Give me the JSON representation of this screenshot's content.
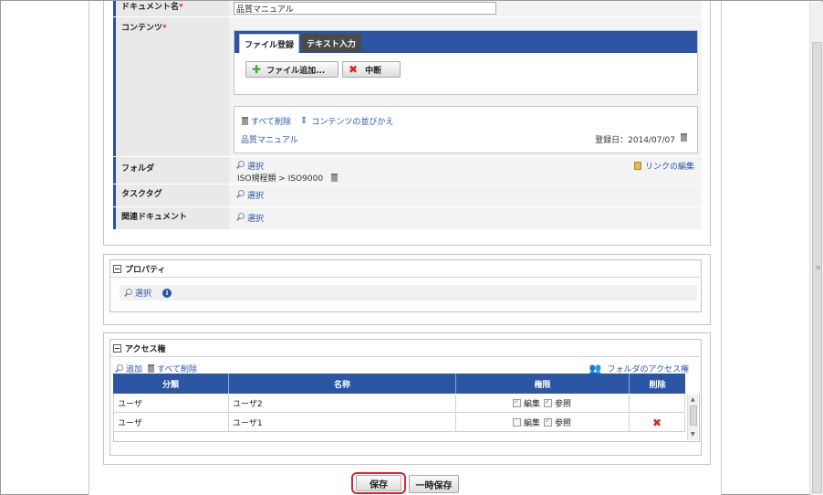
{
  "document": {
    "name_label": "ドキュメント名",
    "name_value": "品質マニュアル",
    "content_label": "コンテンツ",
    "required_mark": "*",
    "tabs": [
      "ファイル登録",
      "テキスト入力"
    ],
    "add_file_button": "ファイル追加...",
    "cancel_button": "中断",
    "delete_all": "すべて削除",
    "reorder": "コンテンツの並びかえ",
    "file_name": "品質マニュアル",
    "file_date": "登録日：2014/07/07",
    "folder_label": "フォルダ",
    "folder_select": "選択",
    "folder_path": "ISO規程類 > ISO9000",
    "link_edit": "リンクの編集",
    "tasktag_label": "タスクタグ",
    "tasktag_select": "選択",
    "related_label": "関連ドキュメント",
    "related_select": "選択"
  },
  "property": {
    "title": "プロパティ",
    "select": "選択"
  },
  "access": {
    "title": "アクセス権",
    "add": "追加",
    "delete_all": "すべて削除",
    "folder_access": "フォルダのアクセス権",
    "headers": [
      "分類",
      "名称",
      "権限",
      "削除"
    ],
    "rows": [
      {
        "type": "ユーザ",
        "name": "ユーザ2",
        "edit": "編集",
        "view": "参照",
        "edit_checked": true,
        "view_checked": true
      },
      {
        "type": "ユーザ",
        "name": "ユーザ1",
        "edit": "編集",
        "view": "参照",
        "edit_checked": false,
        "view_checked": true
      }
    ]
  },
  "footer": {
    "save": "保存",
    "temp_save": "一時保存"
  },
  "colors": {
    "accent": "#2c55a4",
    "highlight": "#d9262c",
    "delete": "#d02828"
  }
}
